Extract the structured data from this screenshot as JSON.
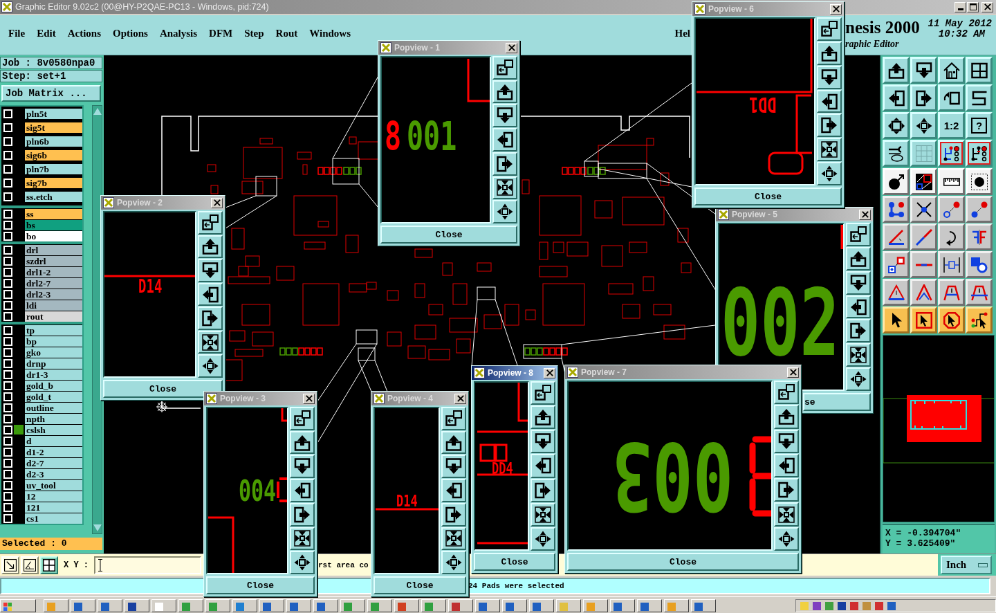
{
  "window": {
    "title": "Graphic Editor 9.02c2 (00@HY-P2QAE-PC13 - Windows, pid:724)"
  },
  "menu": [
    "File",
    "Edit",
    "Actions",
    "Options",
    "Analysis",
    "DFM",
    "Step",
    "Rout",
    "Windows",
    "Hel"
  ],
  "header": {
    "product": "nesis 2000",
    "date": "11 May 2012",
    "time": "10:32 AM",
    "subtitle": "raphic Editor"
  },
  "job": {
    "job": "Job : 8v0580npa0",
    "step": "Step: set+1",
    "matrix_button": "Job Matrix ..."
  },
  "layer_groups": [
    {
      "layers": [
        {
          "name": "pln5t",
          "color": "#a0dcdc",
          "checked": false,
          "affected": false
        },
        {
          "name": "sig5t",
          "color": "#ffc050",
          "checked": false,
          "affected": false
        },
        {
          "name": "pln6b",
          "color": "#a0dcdc",
          "checked": false,
          "affected": false
        },
        {
          "name": "sig6b",
          "color": "#ffc050",
          "checked": false,
          "affected": false
        },
        {
          "name": "pln7b",
          "color": "#a0dcdc",
          "checked": false,
          "affected": false
        },
        {
          "name": "sig7b",
          "color": "#ffc050",
          "checked": false,
          "affected": false
        },
        {
          "name": "ss.etch",
          "color": "#a0dcdc",
          "checked": false,
          "affected": false
        }
      ]
    },
    {
      "layers": [
        {
          "name": "ss",
          "color": "#ffc050",
          "checked": false,
          "affected": false
        },
        {
          "name": "bs",
          "color": "#10a080",
          "checked": false,
          "affected": false
        },
        {
          "name": "bo",
          "color": "#ffffff",
          "checked": false,
          "affected": false
        }
      ]
    },
    {
      "layers": [
        {
          "name": "drl",
          "color": "#a4b8c0",
          "checked": false,
          "affected": false
        },
        {
          "name": "szdrl",
          "color": "#a4b8c0",
          "checked": false,
          "affected": false
        },
        {
          "name": "drl1-2",
          "color": "#a4b8c0",
          "checked": false,
          "affected": false
        },
        {
          "name": "drl2-7",
          "color": "#a4b8c0",
          "checked": false,
          "affected": false
        },
        {
          "name": "drl2-3",
          "color": "#a4b8c0",
          "checked": false,
          "affected": false
        },
        {
          "name": "ldi",
          "color": "#a4b8c0",
          "checked": false,
          "affected": false
        },
        {
          "name": "rout",
          "color": "#d8d8d8",
          "checked": false,
          "affected": false
        }
      ]
    },
    {
      "layers": [
        {
          "name": "tp",
          "color": "#a0dcdc",
          "checked": false,
          "affected": false
        },
        {
          "name": "bp",
          "color": "#a0dcdc",
          "checked": false,
          "affected": false
        },
        {
          "name": "gko",
          "color": "#a0dcdc",
          "checked": false,
          "affected": false
        },
        {
          "name": "drnp",
          "color": "#a0dcdc",
          "checked": false,
          "affected": false
        },
        {
          "name": "dr1-3",
          "color": "#a0dcdc",
          "checked": false,
          "affected": false
        },
        {
          "name": "gold_b",
          "color": "#a0dcdc",
          "checked": false,
          "affected": false
        },
        {
          "name": "gold_t",
          "color": "#a0dcdc",
          "checked": false,
          "affected": false
        },
        {
          "name": "outline",
          "color": "#a0dcdc",
          "checked": false,
          "affected": false
        },
        {
          "name": "npth",
          "color": "#a0dcdc",
          "checked": false,
          "affected": false
        },
        {
          "name": "cslsh",
          "color": "#a0dcdc",
          "checked": false,
          "affected": true
        },
        {
          "name": "d",
          "color": "#a0dcdc",
          "checked": false,
          "affected": false
        },
        {
          "name": "d1-2",
          "color": "#a0dcdc",
          "checked": false,
          "affected": false
        },
        {
          "name": "d2-7",
          "color": "#a0dcdc",
          "checked": false,
          "affected": false
        },
        {
          "name": "d2-3",
          "color": "#a0dcdc",
          "checked": false,
          "affected": false
        },
        {
          "name": "uv_tool",
          "color": "#a0dcdc",
          "checked": false,
          "affected": false
        },
        {
          "name": "12",
          "color": "#a0dcdc",
          "checked": false,
          "affected": false
        },
        {
          "name": "121",
          "color": "#a0dcdc",
          "checked": false,
          "affected": false
        },
        {
          "name": "cs1",
          "color": "#a0dcdc",
          "checked": false,
          "affected": false
        }
      ]
    }
  ],
  "selection": "Selected : 0",
  "bottom_bar": {
    "tools": [
      {
        "on": false
      },
      {
        "on": false
      },
      {
        "on": true
      }
    ],
    "coordinate_label": "X Y :",
    "message": "rst area co",
    "unit": "Inch"
  },
  "status_line": "24 Pads were selected",
  "toolbar": {
    "text_buttons": [
      "1:2",
      "?"
    ]
  },
  "cursor_position": {
    "x": "X = -0.394704\"",
    "y": "Y = 3.625409\""
  },
  "popviews": [
    {
      "title": "Popview - 1",
      "active": false,
      "labels": [
        {
          "text": "8",
          "color": "#ff0000",
          "kind": "upright"
        },
        {
          "text": "001",
          "color": "#4a9a00",
          "kind": "upright"
        }
      ],
      "close": "Close"
    },
    {
      "title": "Popview - 2",
      "active": false,
      "labels": [
        {
          "text": "D14",
          "color": "#ff0000",
          "kind": "upright"
        }
      ],
      "close": "Close"
    },
    {
      "title": "Popview - 3",
      "active": false,
      "labels": [
        {
          "text": "004",
          "color": "#4a9a00",
          "kind": "upright"
        }
      ],
      "close": "Close"
    },
    {
      "title": "Popview - 4",
      "active": false,
      "labels": [
        {
          "text": "D14",
          "color": "#ff0000",
          "kind": "upright"
        }
      ],
      "close": "Close"
    },
    {
      "title": "Popview - 5",
      "active": false,
      "labels": [
        {
          "text": "002",
          "color": "#4a9a00",
          "kind": "upright"
        }
      ],
      "close": "se"
    },
    {
      "title": "Popview - 6",
      "active": false,
      "labels": [
        {
          "text": "DD1",
          "color": "#ff0000",
          "kind": "rotated"
        }
      ],
      "close": "Close"
    },
    {
      "title": "Popview - 7",
      "active": false,
      "labels": [
        {
          "text": "003",
          "color": "#4a9a00",
          "kind": "rotated"
        }
      ],
      "close": "Close"
    },
    {
      "title": "Popview - 8",
      "active": true,
      "labels": [
        {
          "text": "DD4",
          "color": "#ff0000",
          "kind": "upright"
        }
      ],
      "close": "Close"
    }
  ]
}
